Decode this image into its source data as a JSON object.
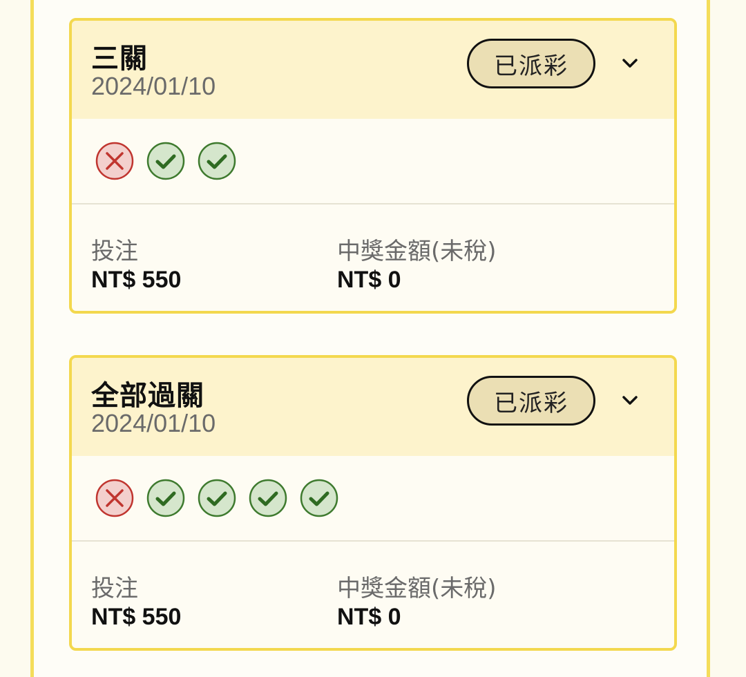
{
  "cards": [
    {
      "title": "三關",
      "date": "2024/01/10",
      "status": "已派彩",
      "results": [
        "lost",
        "won",
        "won"
      ],
      "stake_label": "投注",
      "stake_value": "NT$ 550",
      "payout_label": "中獎金額(未稅)",
      "payout_value": "NT$ 0"
    },
    {
      "title": "全部過關",
      "date": "2024/01/10",
      "status": "已派彩",
      "results": [
        "lost",
        "won",
        "won",
        "won",
        "won"
      ],
      "stake_label": "投注",
      "stake_value": "NT$ 550",
      "payout_label": "中獎金額(未稅)",
      "payout_value": "NT$ 0"
    }
  ],
  "icons": {
    "lost": "x-circle-icon",
    "won": "check-circle-icon",
    "expand": "chevron-down-icon"
  },
  "colors": {
    "card_border": "#f3d84e",
    "header_bg": "#fdf3cc",
    "badge_bg": "#ebdfb4",
    "lost_red": "#c0352f",
    "won_green": "#3e7a2e"
  }
}
